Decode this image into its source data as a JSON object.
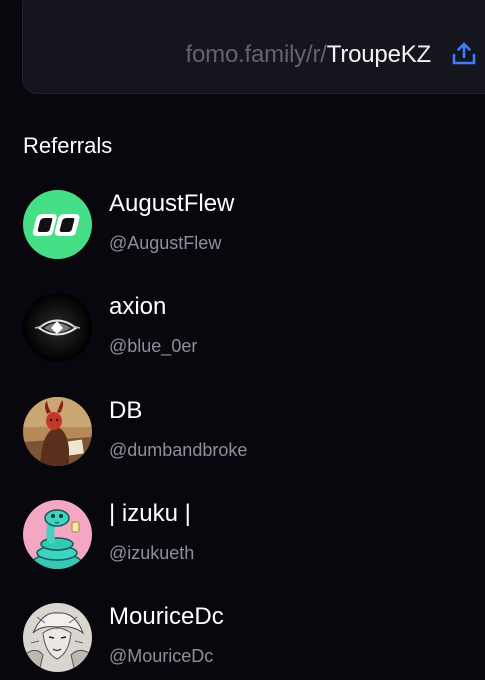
{
  "referral_link": {
    "prefix": "fomo.family/r/",
    "handle": "TroupeKZ",
    "share_icon": "share-upload-icon",
    "accent": "#3e7bff"
  },
  "referrals": {
    "title": "Referrals",
    "items": [
      {
        "name": "AugustFlew",
        "handle": "@AugustFlew",
        "avatar": "green-rounded-eyes-avatar"
      },
      {
        "name": "axion",
        "handle": "@blue_0er",
        "avatar": "black-eye-logo-avatar"
      },
      {
        "name": "DB",
        "handle": "@dumbandbroke",
        "avatar": "devil-painting-avatar"
      },
      {
        "name": "| izuku |",
        "handle": "@izukueth",
        "avatar": "teal-snake-avatar"
      },
      {
        "name": "MouriceDc",
        "handle": "@MouriceDc",
        "avatar": "manga-sketch-avatar"
      }
    ]
  }
}
